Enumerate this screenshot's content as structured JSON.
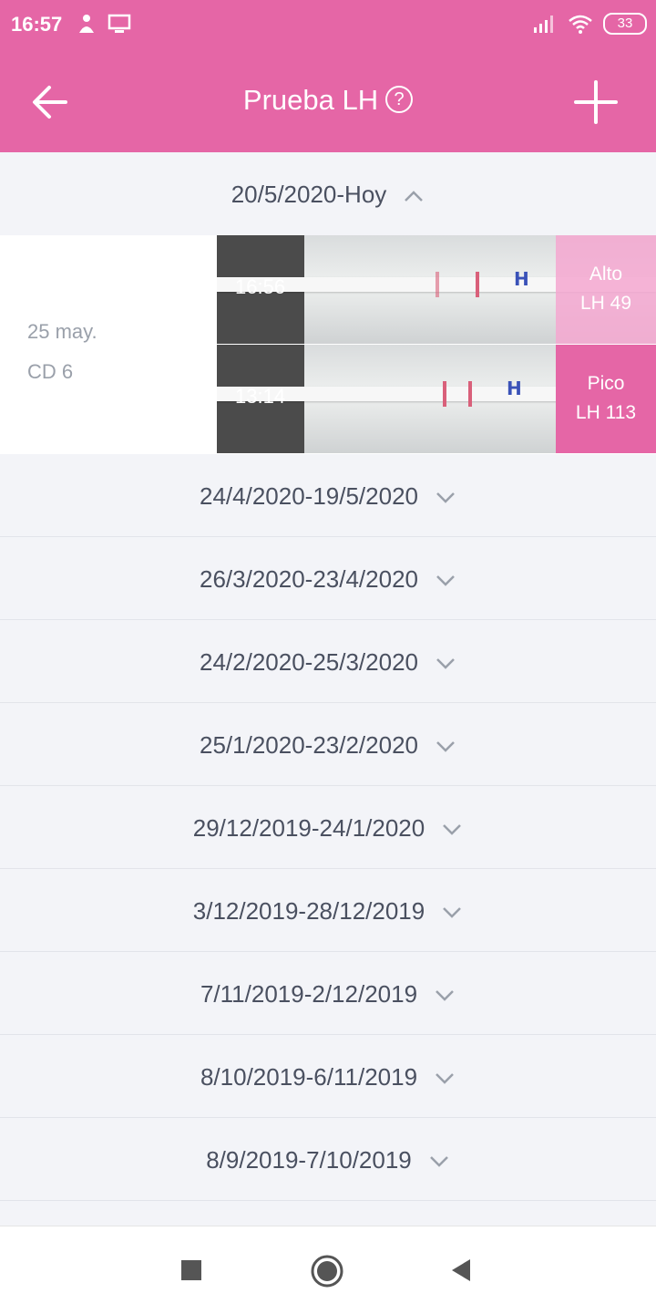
{
  "status_bar": {
    "time": "16:57",
    "battery": "33"
  },
  "header": {
    "title": "Prueba LH",
    "help_icon": "?"
  },
  "current_group": {
    "label": "20/5/2020-Hoy",
    "expanded": true
  },
  "day": {
    "date": "25 may.",
    "cycle_day": "CD 6"
  },
  "tests": [
    {
      "time": "16:56",
      "result_level": "Alto",
      "result_value": "LH 49",
      "color": "#f4a7d0"
    },
    {
      "time": "13:14",
      "result_level": "Pico",
      "result_value": "LH 113",
      "color": "#e566a6"
    }
  ],
  "groups": [
    {
      "label": "24/4/2020-19/5/2020"
    },
    {
      "label": "26/3/2020-23/4/2020"
    },
    {
      "label": "24/2/2020-25/3/2020"
    },
    {
      "label": "25/1/2020-23/2/2020"
    },
    {
      "label": "29/12/2019-24/1/2020"
    },
    {
      "label": "3/12/2019-28/12/2019"
    },
    {
      "label": "7/11/2019-2/12/2019"
    },
    {
      "label": "8/10/2019-6/11/2019"
    },
    {
      "label": "8/9/2019-7/10/2019"
    }
  ],
  "colors": {
    "accent": "#e566a6",
    "background": "#f3f4f8",
    "text": "#4a5060"
  }
}
